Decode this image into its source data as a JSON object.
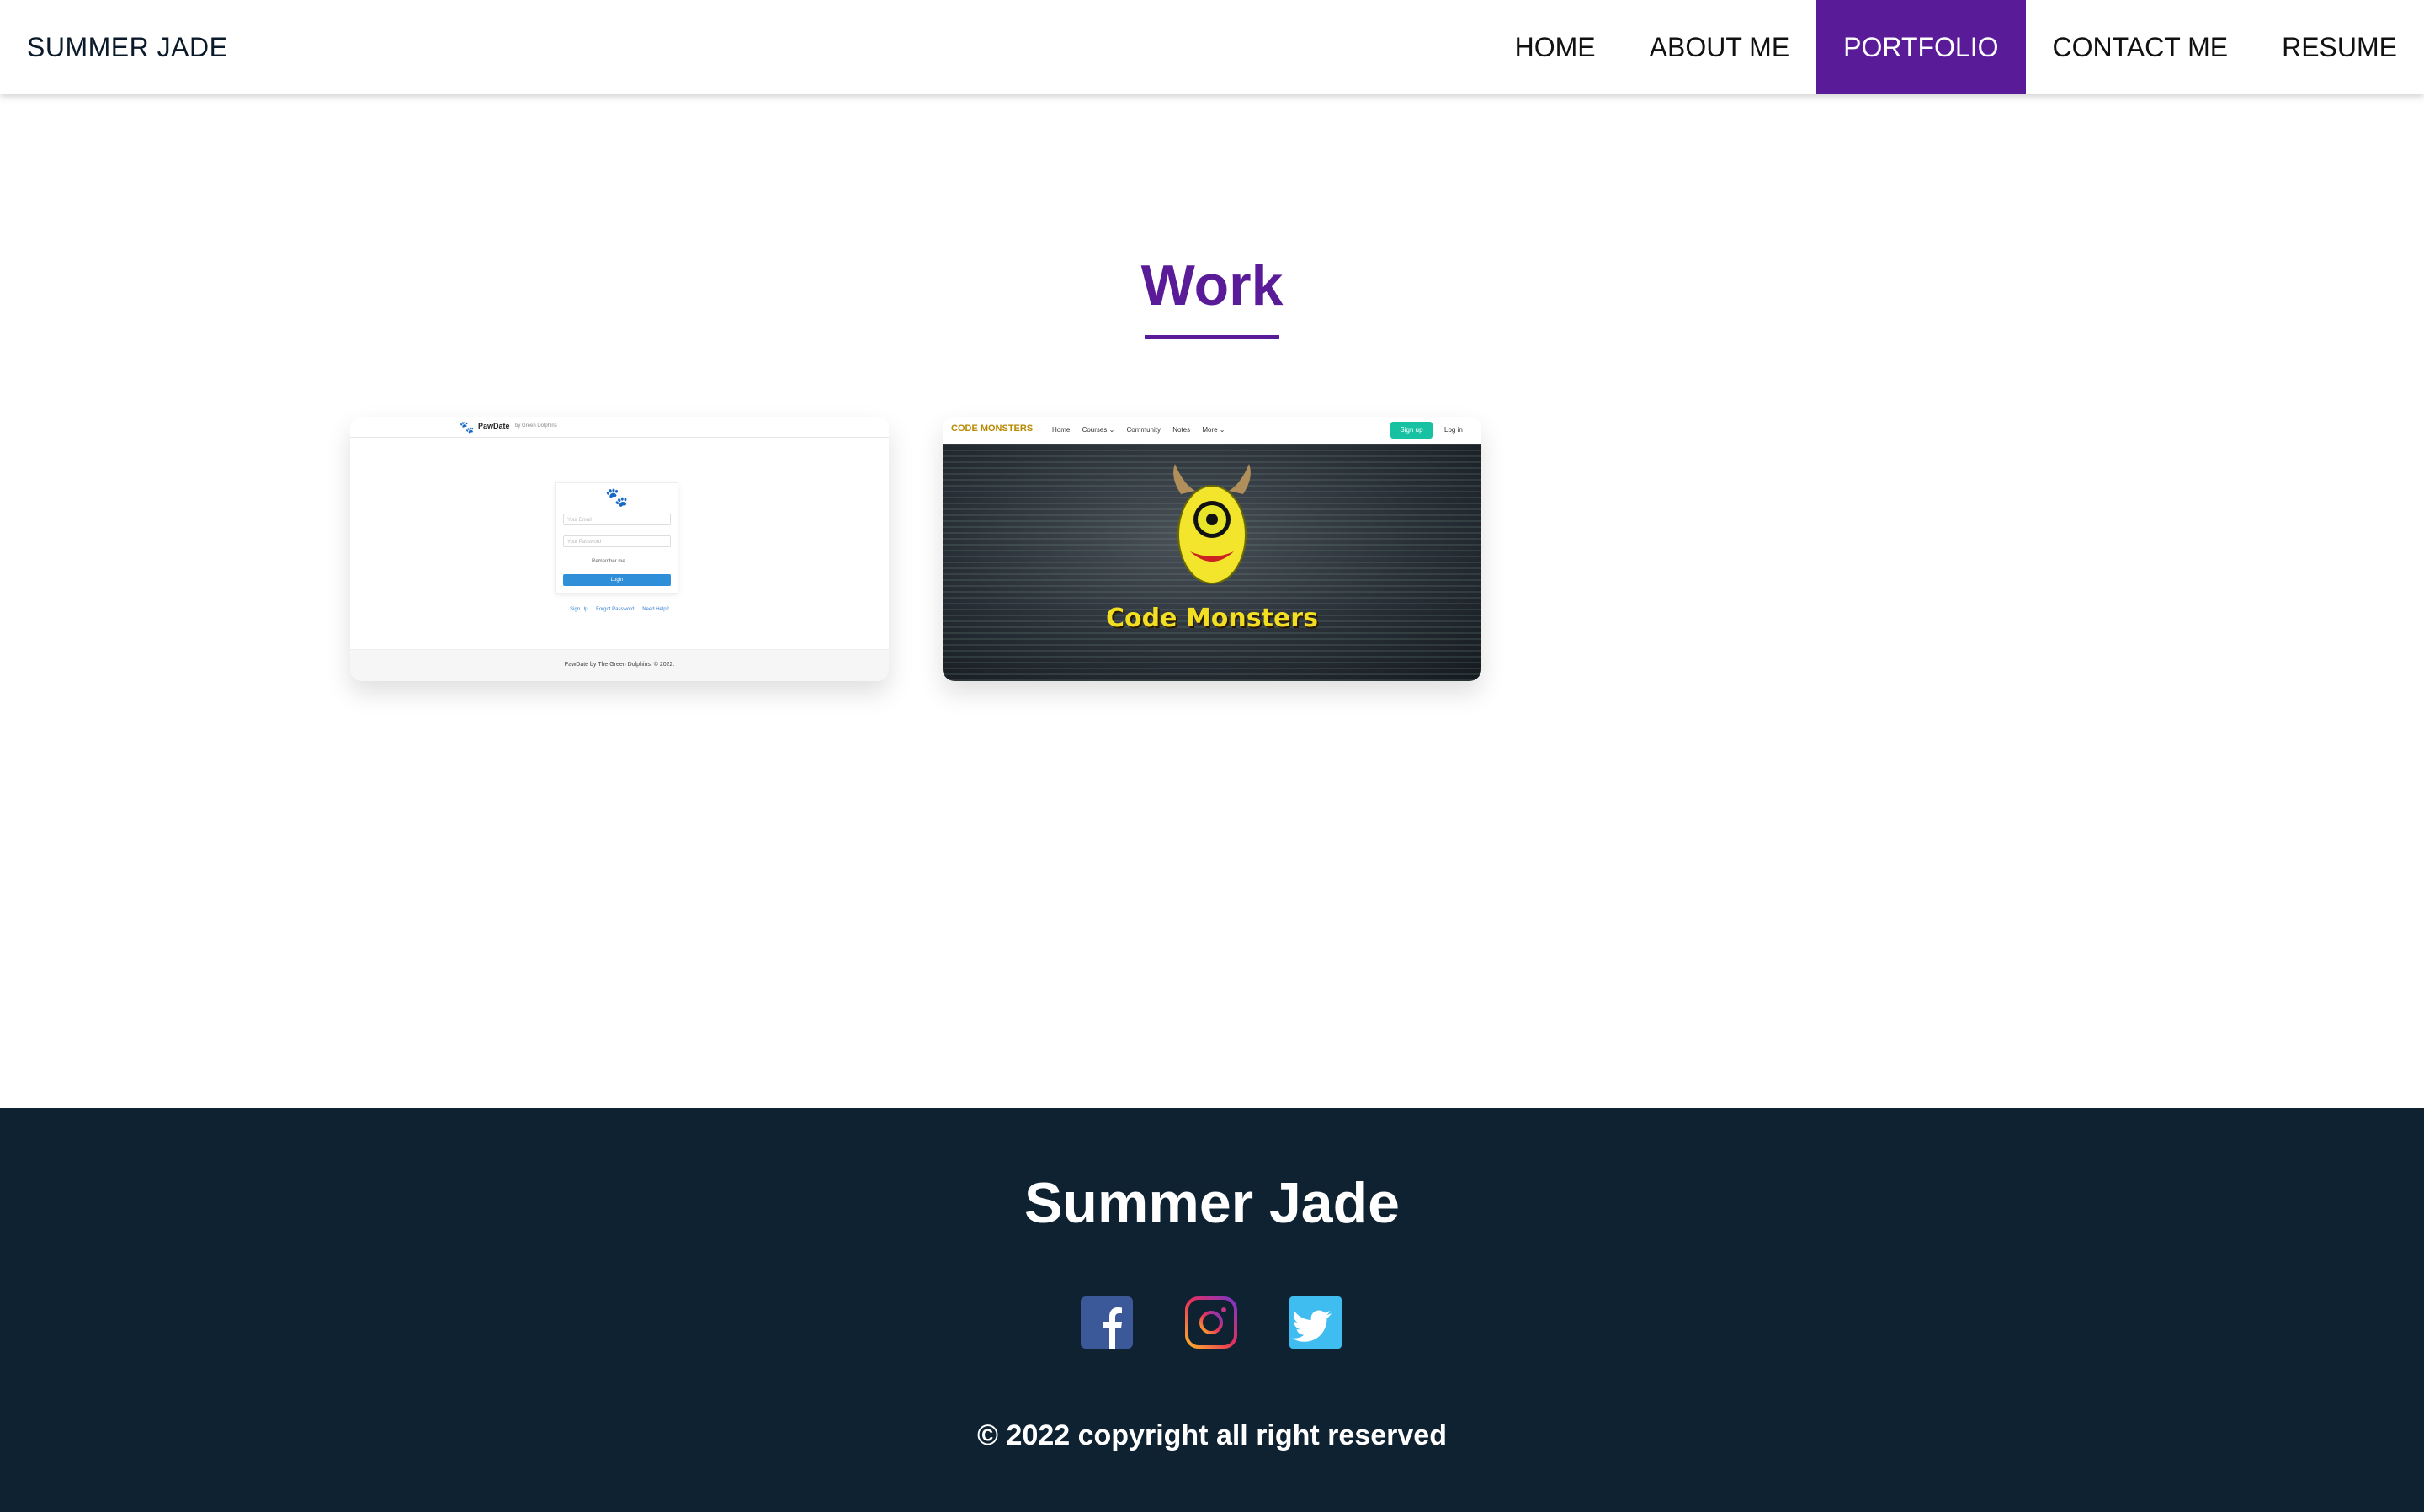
{
  "nav": {
    "brand": "SUMMER JADE",
    "items": [
      {
        "label": "HOME"
      },
      {
        "label": "ABOUT ME"
      },
      {
        "label": "PORTFOLIO",
        "active": true
      },
      {
        "label": "CONTACT ME"
      },
      {
        "label": "RESUME"
      }
    ],
    "active_color": "#5a1b99"
  },
  "main": {
    "title": "Work",
    "projects": [
      {
        "name": "PawDate",
        "by": "by Green Dolphins",
        "email_placeholder": "Your Email",
        "password_placeholder": "Your Password",
        "remember": "Remember me",
        "login": "Login",
        "links": [
          "Sign Up",
          "Forgot Password",
          "Need Help?"
        ],
        "footer": "PawDate by The Green Dolphins. © 2022."
      },
      {
        "name": "CODE MONSTERS",
        "nav": [
          "Home",
          "Courses ⌄",
          "Community",
          "Notes",
          "More ⌄"
        ],
        "signup": "Sign up",
        "login": "Log in",
        "hero_title": "Code Monsters"
      }
    ]
  },
  "footer": {
    "name": "Summer Jade",
    "copyright": "© 2022 copyright all right reserved",
    "social": [
      "facebook-icon",
      "instagram-icon",
      "twitter-icon"
    ],
    "bg": "#0e2232"
  }
}
